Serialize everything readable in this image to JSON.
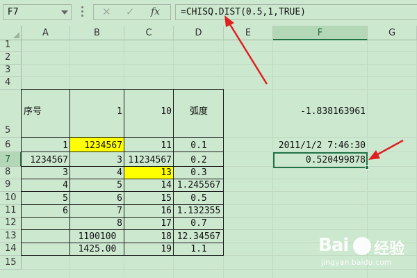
{
  "name_box": "F7",
  "formula_bar": {
    "cancel_icon": "x-icon",
    "enter_icon": "check-icon",
    "fx_label": "fx",
    "formula": "=CHISQ.DIST(0.5,1,TRUE)"
  },
  "columns": [
    "A",
    "B",
    "C",
    "D",
    "E",
    "F",
    "G"
  ],
  "selected_column": "F",
  "rows": [
    "1",
    "2",
    "3",
    "4",
    "5",
    "6",
    "7",
    "8",
    "9",
    "10",
    "11",
    "12",
    "13",
    "14",
    "15"
  ],
  "selected_row": "7",
  "cells": {
    "A5": "序号",
    "B5": "1",
    "C5": "10",
    "D5": "弧度",
    "F5": "-1.838163961",
    "A6": "1",
    "B6": "1234567",
    "C6": "11",
    "D6": "0.1",
    "F6": "2011/1/2 7:46:30",
    "A7": "1234567",
    "B7": "3",
    "C7": "11234567",
    "D7": "0.2",
    "F7": "0.520499878",
    "A8": "3",
    "B8": "4",
    "C8": "13",
    "D8": "0.3",
    "A9": "4",
    "B9": "5",
    "C9": "14",
    "D9": "1.245567",
    "A10": "5",
    "B10": "6",
    "C10": "15",
    "D10": "0.5",
    "A11": "6",
    "B11": "7",
    "C11": "16",
    "D11": "1.132355",
    "B12": "8",
    "C12": "17",
    "D12": "0.7",
    "B13": "1100100",
    "C13": "18",
    "D13": "12.34567",
    "B14": "1425.00",
    "C14": "19",
    "D14": "1.1"
  },
  "highlight_color": "#ffff00",
  "accent_color": "#217346",
  "annotation_color": "#e02020",
  "watermark": {
    "brand": "Bai",
    "brand2": "经验",
    "url": "jingyan.baidu.com"
  }
}
